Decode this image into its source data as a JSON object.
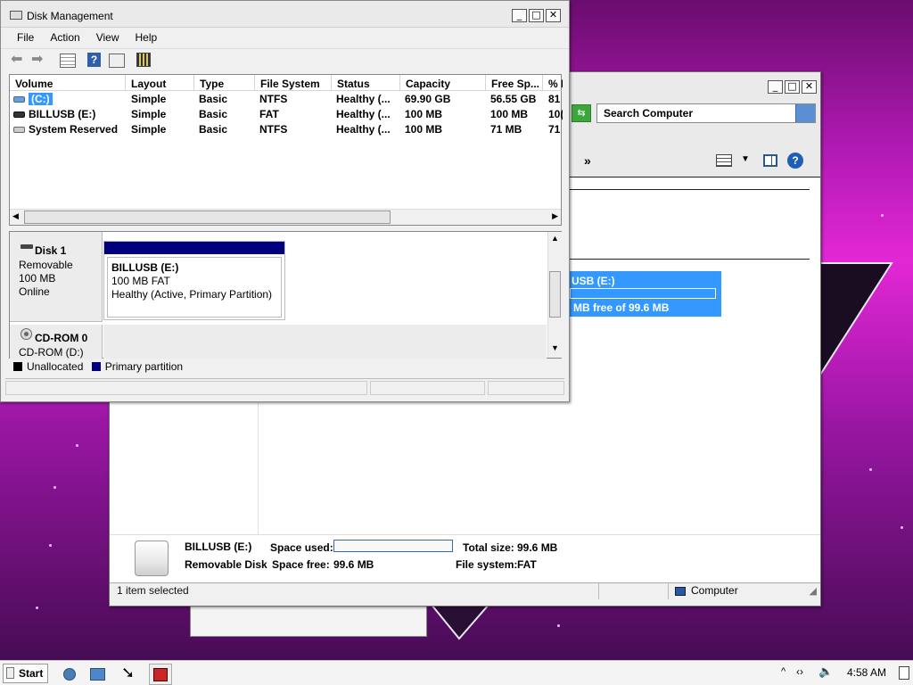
{
  "dm": {
    "title": "Disk Management",
    "menu": [
      "File",
      "Action",
      "View",
      "Help"
    ],
    "columns": [
      "Volume",
      "Layout",
      "Type",
      "File System",
      "Status",
      "Capacity",
      "Free Sp...",
      "% F"
    ],
    "rows": [
      {
        "volume": "(C:)",
        "layout": "Simple",
        "type": "Basic",
        "fs": "NTFS",
        "status": "Healthy (...",
        "capacity": "69.90 GB",
        "free": "56.55 GB",
        "pct": "81"
      },
      {
        "volume": "BILLUSB (E:)",
        "layout": "Simple",
        "type": "Basic",
        "fs": "FAT",
        "status": "Healthy (...",
        "capacity": "100 MB",
        "free": "100 MB",
        "pct": "10("
      },
      {
        "volume": "System Reserved",
        "layout": "Simple",
        "type": "Basic",
        "fs": "NTFS",
        "status": "Healthy (...",
        "capacity": "100 MB",
        "free": "71 MB",
        "pct": "71"
      }
    ],
    "disk1": {
      "name": "Disk 1",
      "type": "Removable",
      "size": "100 MB",
      "state": "Online"
    },
    "partition": {
      "name": "BILLUSB  (E:)",
      "size": "100 MB FAT",
      "status": "Healthy (Active, Primary Partition)"
    },
    "cdrom": {
      "name": "CD-ROM 0",
      "drive": "CD-ROM (D:)"
    },
    "legend": {
      "unallocated": "Unallocated",
      "primary": "Primary partition"
    }
  },
  "explorer": {
    "search_placeholder": "Search Computer",
    "chevron": "»",
    "tile_name": "USB (E:)",
    "tile_free": "MB free of 99.6 MB",
    "details": {
      "name": "BILLUSB (E:)",
      "kind": "Removable Disk",
      "space_used_label": "Space used:",
      "space_free_label": "Space free:",
      "space_free_value": "99.6 MB",
      "total_size_label": "Total size:",
      "total_size_value": "99.6 MB",
      "fs_label": "File system:",
      "fs_value": "FAT"
    },
    "status_selected": "1 item selected",
    "status_location": "Computer"
  },
  "taskbar": {
    "start": "Start",
    "time": "4:58 AM"
  },
  "colors": {
    "primary_partition": "#00007f",
    "selection": "#3399ff",
    "title_bg": "#eaeaea"
  }
}
